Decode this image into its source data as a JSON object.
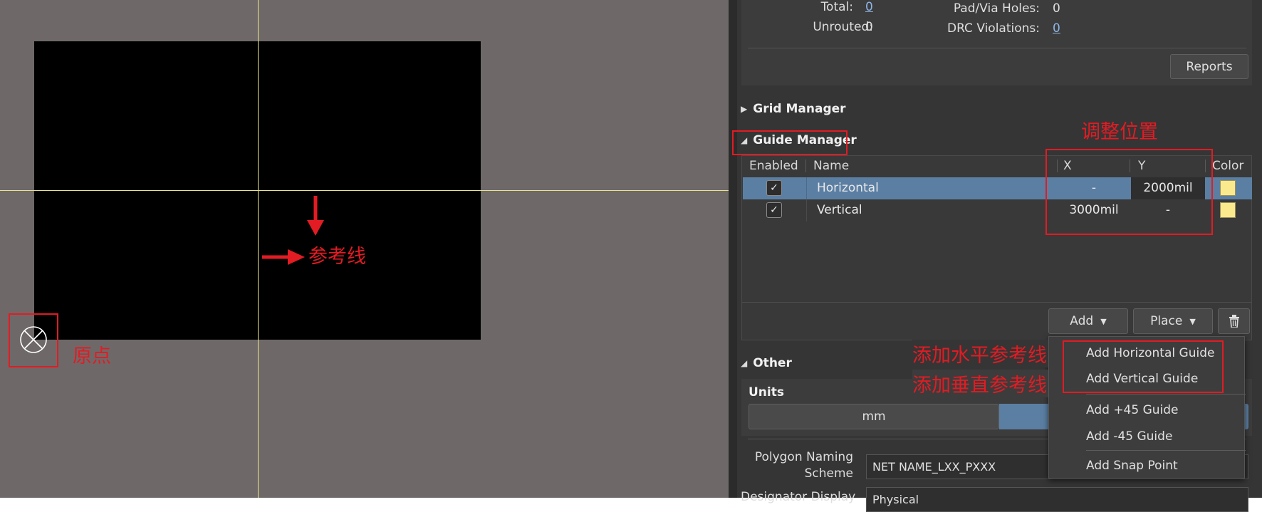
{
  "stats": {
    "total_label": "Total:",
    "total_value": "0",
    "unrouted_label": "Unrouted:",
    "unrouted_value": "0",
    "holes_label": "Pad/Via Holes:",
    "holes_value": "0",
    "drc_label": "DRC Violations:",
    "drc_value": "0",
    "reports_button": "Reports"
  },
  "grid_manager": {
    "title": "Grid Manager"
  },
  "guide_manager": {
    "title": "Guide Manager",
    "columns": [
      "Enabled",
      "Name",
      "X",
      "Y",
      "Color"
    ],
    "rows": [
      {
        "enabled": true,
        "name": "Horizontal",
        "x": "-",
        "y": "2000mil",
        "color": "#fbe98d",
        "selected": true
      },
      {
        "enabled": true,
        "name": "Vertical",
        "x": "3000mil",
        "y": "-",
        "color": "#fbe98d",
        "selected": false
      }
    ],
    "add_button": "Add",
    "place_button": "Place",
    "delete_icon": "trash-icon"
  },
  "add_menu": {
    "items": [
      "Add Horizontal Guide",
      "Add Vertical Guide",
      "Add +45 Guide",
      "Add -45 Guide",
      "Add Snap Point"
    ]
  },
  "other": {
    "title": "Other",
    "units_label": "Units",
    "units_options": [
      "mm"
    ],
    "polygon_naming_label_1": "Polygon Naming",
    "polygon_naming_label_2": "Scheme",
    "polygon_naming_value": "NET NAME_LXX_PXXX",
    "designator_display_label": "Designator Display",
    "designator_display_value": "Physical"
  },
  "annotations": {
    "adjust_position": "调整位置",
    "reference_line": "参考线",
    "origin": "原点",
    "add_horizontal": "添加水平参考线",
    "add_vertical": "添加垂直参考线"
  },
  "colors": {
    "canvas_bg": "#6e6968",
    "board": "#000000",
    "guide_line": "#e8e38c",
    "annotation_red": "#e31b23",
    "selected_row": "#5b7fa3",
    "link": "#8fb5e6"
  }
}
